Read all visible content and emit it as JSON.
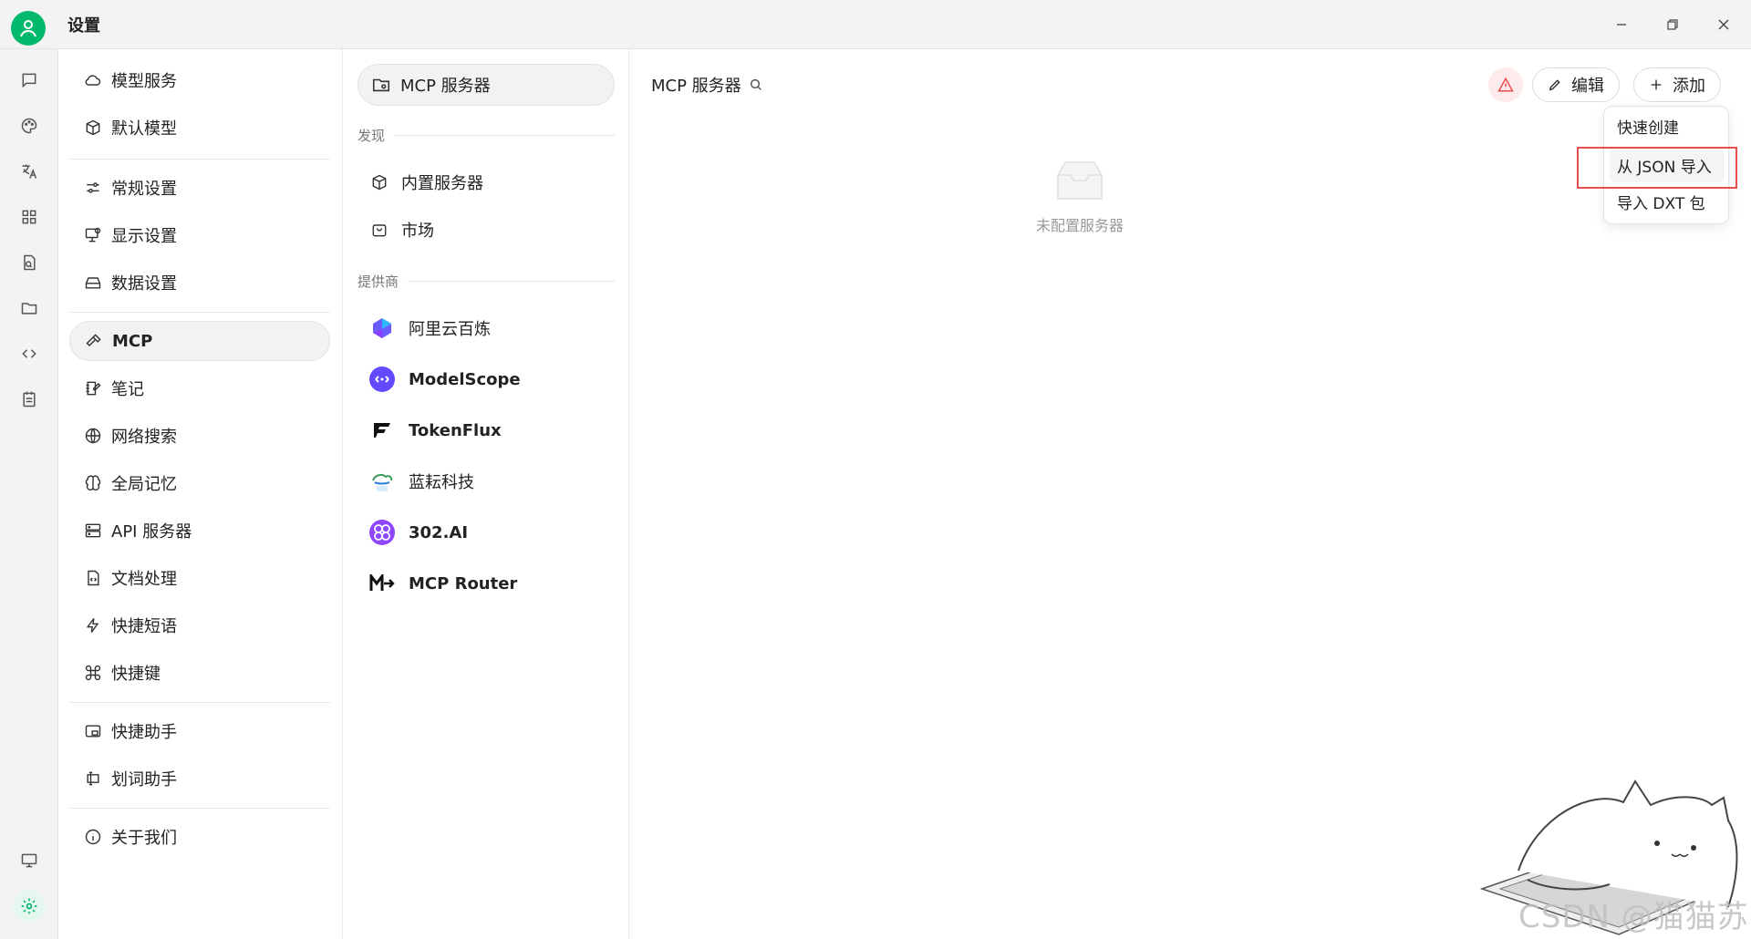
{
  "window": {
    "title": "设置"
  },
  "rail": {
    "icons": [
      "chat-icon",
      "palette-icon",
      "translate-icon",
      "apps-grid-icon",
      "file-search-icon",
      "folder-icon",
      "code-icon",
      "notes-icon",
      "monitor-icon",
      "settings-gear-icon"
    ]
  },
  "settings_nav": {
    "items": [
      {
        "label": "模型服务",
        "icon": "cloud-icon"
      },
      {
        "label": "默认模型",
        "icon": "cube-icon"
      },
      {
        "label": "常规设置",
        "icon": "sliders-icon"
      },
      {
        "label": "显示设置",
        "icon": "monitor-settings-icon"
      },
      {
        "label": "数据设置",
        "icon": "database-icon"
      },
      {
        "label": "MCP",
        "icon": "hammer-icon",
        "active": true
      },
      {
        "label": "笔记",
        "icon": "note-edit-icon"
      },
      {
        "label": "网络搜索",
        "icon": "globe-icon"
      },
      {
        "label": "全局记忆",
        "icon": "brain-icon"
      },
      {
        "label": "API 服务器",
        "icon": "server-icon"
      },
      {
        "label": "文档处理",
        "icon": "document-code-icon"
      },
      {
        "label": "快捷短语",
        "icon": "lightning-icon"
      },
      {
        "label": "快捷键",
        "icon": "command-icon"
      },
      {
        "label": "快捷助手",
        "icon": "window-assistant-icon"
      },
      {
        "label": "划词助手",
        "icon": "text-select-icon"
      },
      {
        "label": "关于我们",
        "icon": "info-icon"
      }
    ]
  },
  "mcp_nav": {
    "top_label": "MCP 服务器",
    "discover_label": "发现",
    "discover_items": [
      {
        "label": "内置服务器",
        "icon": "box-icon"
      },
      {
        "label": "市场",
        "icon": "shopping-bag-icon"
      }
    ],
    "providers_label": "提供商",
    "providers": [
      {
        "label": "阿里云百炼",
        "icon": "bailian-logo"
      },
      {
        "label": "ModelScope",
        "icon": "modelscope-logo"
      },
      {
        "label": "TokenFlux",
        "icon": "tokenflux-logo"
      },
      {
        "label": "蓝耘科技",
        "icon": "lanyun-logo"
      },
      {
        "label": "302.AI",
        "icon": "302ai-logo"
      },
      {
        "label": "MCP Router",
        "icon": "mcprouter-logo"
      }
    ]
  },
  "main": {
    "title": "MCP 服务器",
    "edit_label": "编辑",
    "add_label": "添加",
    "empty_text": "未配置服务器",
    "dropdown": [
      "快速创建",
      "从 JSON 导入",
      "导入 DXT 包"
    ]
  },
  "watermark": "CSDN @猫猫苏",
  "colors": {
    "accent": "#00b96b",
    "warning": "#e84d4d"
  }
}
